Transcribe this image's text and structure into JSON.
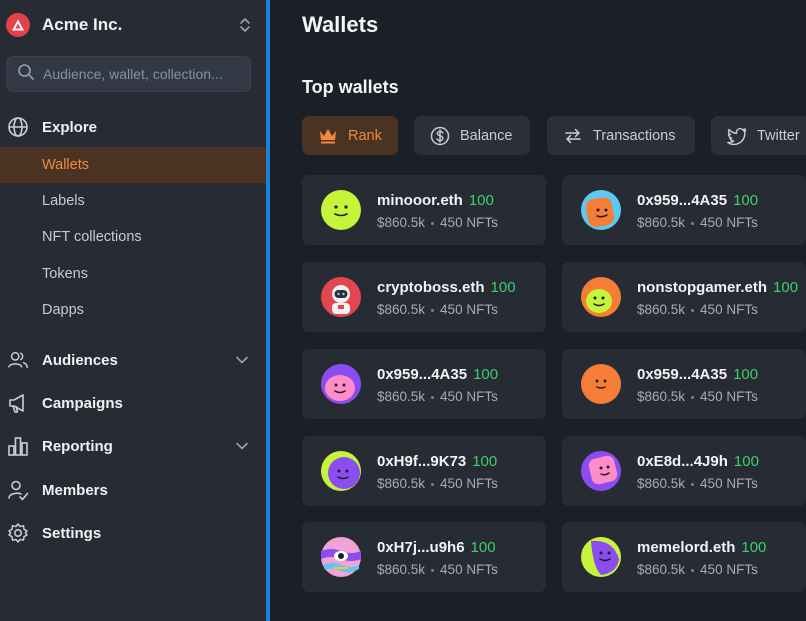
{
  "org": {
    "name": "Acme Inc."
  },
  "search": {
    "placeholder": "Audience, wallet, collection..."
  },
  "nav": {
    "explore": "Explore",
    "explore_items": [
      "Wallets",
      "Labels",
      "NFT collections",
      "Tokens",
      "Dapps"
    ],
    "audiences": "Audiences",
    "campaigns": "Campaigns",
    "reporting": "Reporting",
    "members": "Members",
    "settings": "Settings"
  },
  "main": {
    "title": "Wallets",
    "section_title": "Top wallets",
    "tabs": [
      "Rank",
      "Balance",
      "Transactions",
      "Twitter"
    ]
  },
  "wallets": [
    {
      "name": "minooor.eth",
      "score": "100",
      "balance": "$860.5k",
      "nfts": "450 NFTs"
    },
    {
      "name": "0x959...4A35",
      "score": "100",
      "balance": "$860.5k",
      "nfts": "450 NFTs"
    },
    {
      "name": "cryptoboss.eth",
      "score": "100",
      "balance": "$860.5k",
      "nfts": "450 NFTs"
    },
    {
      "name": "nonstopgamer.eth",
      "score": "100",
      "balance": "$860.5k",
      "nfts": "450 NFTs"
    },
    {
      "name": "0x959...4A35",
      "score": "100",
      "balance": "$860.5k",
      "nfts": "450 NFTs"
    },
    {
      "name": "0x959...4A35",
      "score": "100",
      "balance": "$860.5k",
      "nfts": "450 NFTs"
    },
    {
      "name": "0xH9f...9K73",
      "score": "100",
      "balance": "$860.5k",
      "nfts": "450 NFTs"
    },
    {
      "name": "0xE8d...4J9h",
      "score": "100",
      "balance": "$860.5k",
      "nfts": "450 NFTs"
    },
    {
      "name": "0xH7j...u9h6",
      "score": "100",
      "balance": "$860.5k",
      "nfts": "450 NFTs"
    },
    {
      "name": "memelord.eth",
      "score": "100",
      "balance": "$860.5k",
      "nfts": "450 NFTs"
    }
  ],
  "colors": {
    "accent": "#f08a3c",
    "active_bg": "#4a3323",
    "score_green": "#3ecf6a",
    "divider": "#1e7fd6"
  }
}
